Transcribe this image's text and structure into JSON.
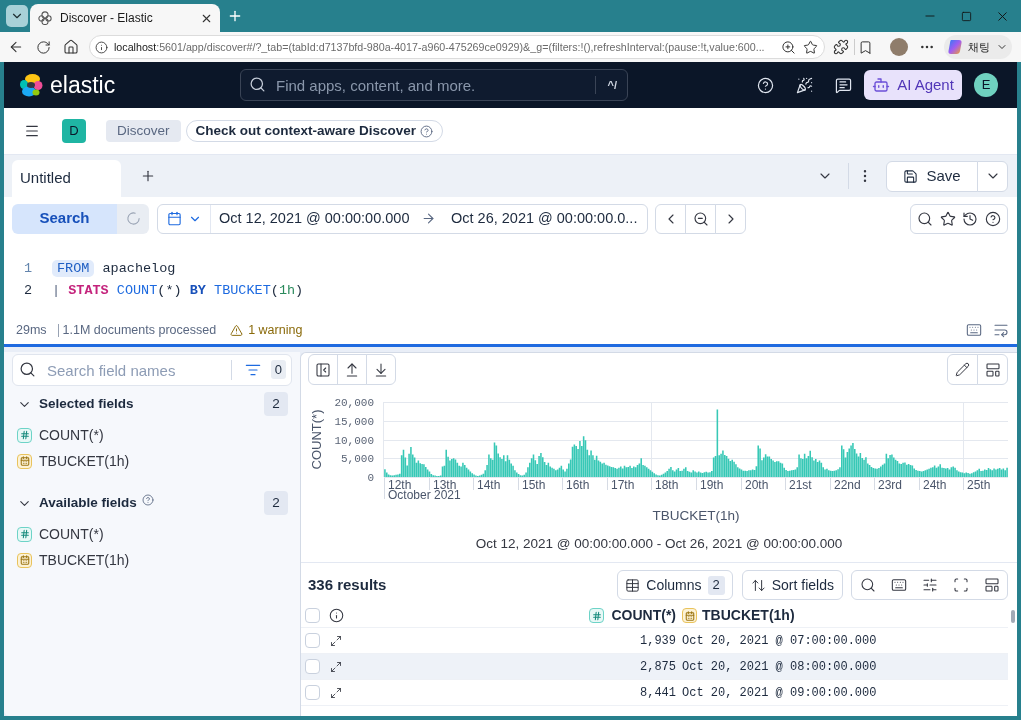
{
  "browser": {
    "tab_title": "Discover - Elastic",
    "url_host": "localhost",
    "url_rest": ":5601/app/discover#/?_tab=(tabId:d7137bfd-980a-4017-a960-475269ce0929)&_g=(filters:!(),refreshInterval:(pause:!t,value:600...",
    "chat_label": "채팅"
  },
  "header": {
    "brand": "elastic",
    "search_placeholder": "Find apps, content, and more.",
    "shortcut": "^/",
    "ai_button": "AI Agent",
    "avatar_initial": "E"
  },
  "breadcrumbs": {
    "space_initial": "D",
    "items": [
      "Discover"
    ],
    "callout": "Check out context-aware Discover"
  },
  "tabs": [
    {
      "label": "Untitled",
      "selected": true
    }
  ],
  "save_button": "Save",
  "query_bar": {
    "search_button": "Search",
    "date_start": "Oct 12, 2021 @ 00:00:00.000",
    "date_end": "Oct 26, 2021 @ 00:00:00.0..."
  },
  "editor": {
    "lines": [
      {
        "number": "1",
        "active": false,
        "tokens": [
          {
            "kind": "source",
            "text": "FROM"
          },
          {
            "kind": "plain",
            "text": " apachelog"
          }
        ]
      },
      {
        "number": "2",
        "active": true,
        "tokens": [
          {
            "kind": "pipe",
            "text": "| "
          },
          {
            "kind": "keyword",
            "text": "STATS "
          },
          {
            "kind": "function",
            "text": "COUNT"
          },
          {
            "kind": "plain",
            "text": "(*) "
          },
          {
            "kind": "operator",
            "text": "BY "
          },
          {
            "kind": "function",
            "text": "TBUCKET"
          },
          {
            "kind": "plain",
            "text": "("
          },
          {
            "kind": "number",
            "text": "1h"
          },
          {
            "kind": "plain",
            "text": ")"
          }
        ]
      }
    ]
  },
  "status": {
    "duration": "29ms",
    "documents": "1.1M documents processed",
    "warning": "1 warning"
  },
  "sidebar": {
    "search_placeholder": "Search field names",
    "filter_count": "0",
    "groups": [
      {
        "title": "Selected fields",
        "count": "2",
        "help": false,
        "expanded": true,
        "fields": [
          {
            "name": "COUNT(*)",
            "kind": "number"
          },
          {
            "name": "TBUCKET(1h)",
            "kind": "date"
          }
        ]
      },
      {
        "title": "Available fields",
        "count": "2",
        "help": true,
        "expanded": true,
        "fields": [
          {
            "name": "COUNT(*)",
            "kind": "number"
          },
          {
            "name": "TBUCKET(1h)",
            "kind": "date"
          }
        ]
      }
    ]
  },
  "histogram": {
    "y_axis_title": "COUNT(*)",
    "y_axis_labels": [
      "20,000",
      "15,000",
      "10,000",
      "5,000",
      "0"
    ],
    "x_axis_labels": [
      "12th",
      "13th",
      "14th",
      "15th",
      "16th",
      "17th",
      "18th",
      "19th",
      "20th",
      "21st",
      "22nd",
      "23rd",
      "24th",
      "25th"
    ],
    "period_label": "October 2021",
    "x_axis_title": "TBUCKET(1h)",
    "range_label": "Oct 12, 2021 @ 00:00:00.000 - Oct 26, 2021 @ 00:00:00.000"
  },
  "results": {
    "count_label": "336 results",
    "columns_button": "Columns",
    "columns_count": "2",
    "sort_button": "Sort fields",
    "all_checked": false,
    "columns": [
      {
        "name": "COUNT(*)",
        "kind": "number"
      },
      {
        "name": "TBUCKET(1h)",
        "kind": "date"
      }
    ],
    "rows": [
      {
        "count": "1,939",
        "timestamp": "Oct 20, 2021 @ 07:00:00.000",
        "checked": false,
        "highlighted": false
      },
      {
        "count": "2,875",
        "timestamp": "Oct 20, 2021 @ 08:00:00.000",
        "checked": false,
        "highlighted": true
      },
      {
        "count": "8,441",
        "timestamp": "Oct 20, 2021 @ 09:00:00.000",
        "checked": false,
        "highlighted": false
      }
    ]
  }
}
